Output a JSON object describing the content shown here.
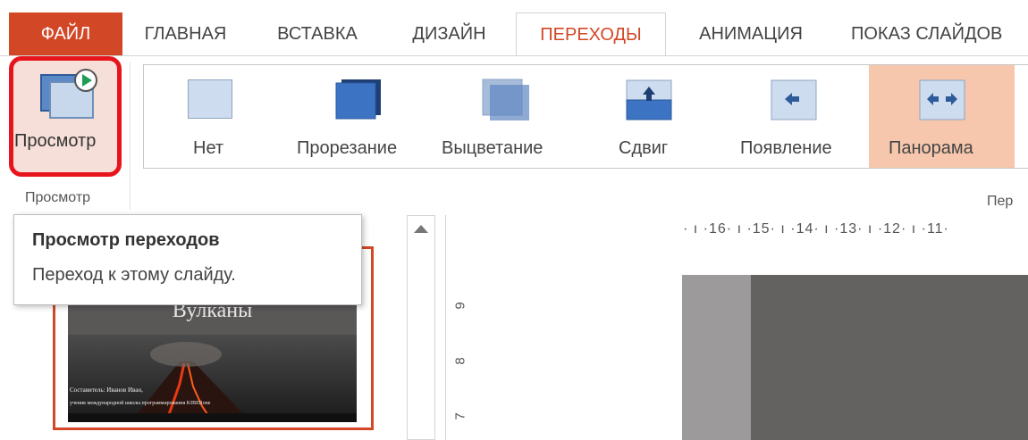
{
  "tabs": {
    "file": "ФАЙЛ",
    "items": [
      "ГЛАВНАЯ",
      "ВСТАВКА",
      "ДИЗАЙН",
      "ПЕРЕХОДЫ",
      "АНИМАЦИЯ",
      "ПОКАЗ СЛАЙДОВ"
    ],
    "active": "ПЕРЕХОДЫ"
  },
  "ribbon": {
    "preview_button_label": "Просмотр",
    "preview_group_label": "Просмотр",
    "transitions_group_label_partial": "Пер",
    "transitions": [
      {
        "label": "Нет",
        "icon": "none-transition-icon"
      },
      {
        "label": "Прорезание",
        "icon": "cut-transition-icon"
      },
      {
        "label": "Выцветание",
        "icon": "fade-transition-icon"
      },
      {
        "label": "Сдвиг",
        "icon": "push-transition-icon"
      },
      {
        "label": "Появление",
        "icon": "wipe-transition-icon"
      },
      {
        "label": "Панорама",
        "icon": "split-transition-icon",
        "selected": true
      }
    ]
  },
  "tooltip": {
    "title": "Просмотр переходов",
    "description": "Переход к этому слайду."
  },
  "slide_thumbnail": {
    "title_partial": "Вулканы",
    "author_line": "Составитель: Иванов Иван,",
    "subtitle_line": "ученик международной школы программирования KIBERone"
  },
  "ruler": {
    "horizontal": "· ı ·16· ı ·15· ı ·14· ı ·13· ı ·12· ı ·11·",
    "vertical": [
      "9",
      "8",
      "7"
    ]
  },
  "colors": {
    "accent": "#d24726",
    "highlight_border": "#e8141c",
    "selected_item": "#f6c7ad"
  }
}
